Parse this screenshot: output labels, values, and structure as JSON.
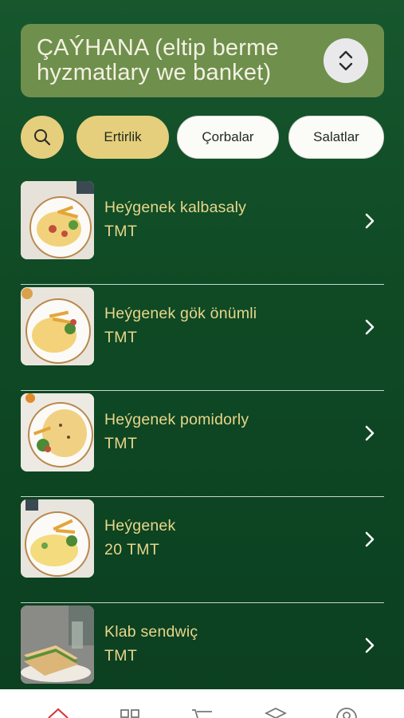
{
  "header": {
    "title": "ÇAÝHANA (eltip berme hyzmatlary we banket)",
    "switch_icon": "chevron-up-down-icon"
  },
  "categories": {
    "search_icon": "search-icon",
    "items": [
      {
        "label": "Ertirlik",
        "active": true
      },
      {
        "label": "Çorbalar",
        "active": false
      },
      {
        "label": "Salatlar",
        "active": false
      }
    ]
  },
  "menu_items": [
    {
      "name": "Heýgenek kalbasaly",
      "price": " TMT"
    },
    {
      "name": "Heýgenek gök önümli",
      "price": " TMT"
    },
    {
      "name": "Heýgenek pomidorly",
      "price": " TMT"
    },
    {
      "name": "Heýgenek",
      "price": "20 TMT"
    },
    {
      "name": "Klab sendwiç",
      "price": " TMT"
    }
  ],
  "bottom_nav": {
    "items": [
      "home-icon",
      "grid-icon",
      "cart-icon",
      "box-icon",
      "profile-icon"
    ],
    "active_index": 0
  },
  "colors": {
    "background": "#0f4a25",
    "header_bg": "#6f8f4c",
    "accent_gold": "#e5cf7c",
    "item_text": "#e8d68a",
    "nav_indicator": "#d9312e"
  }
}
